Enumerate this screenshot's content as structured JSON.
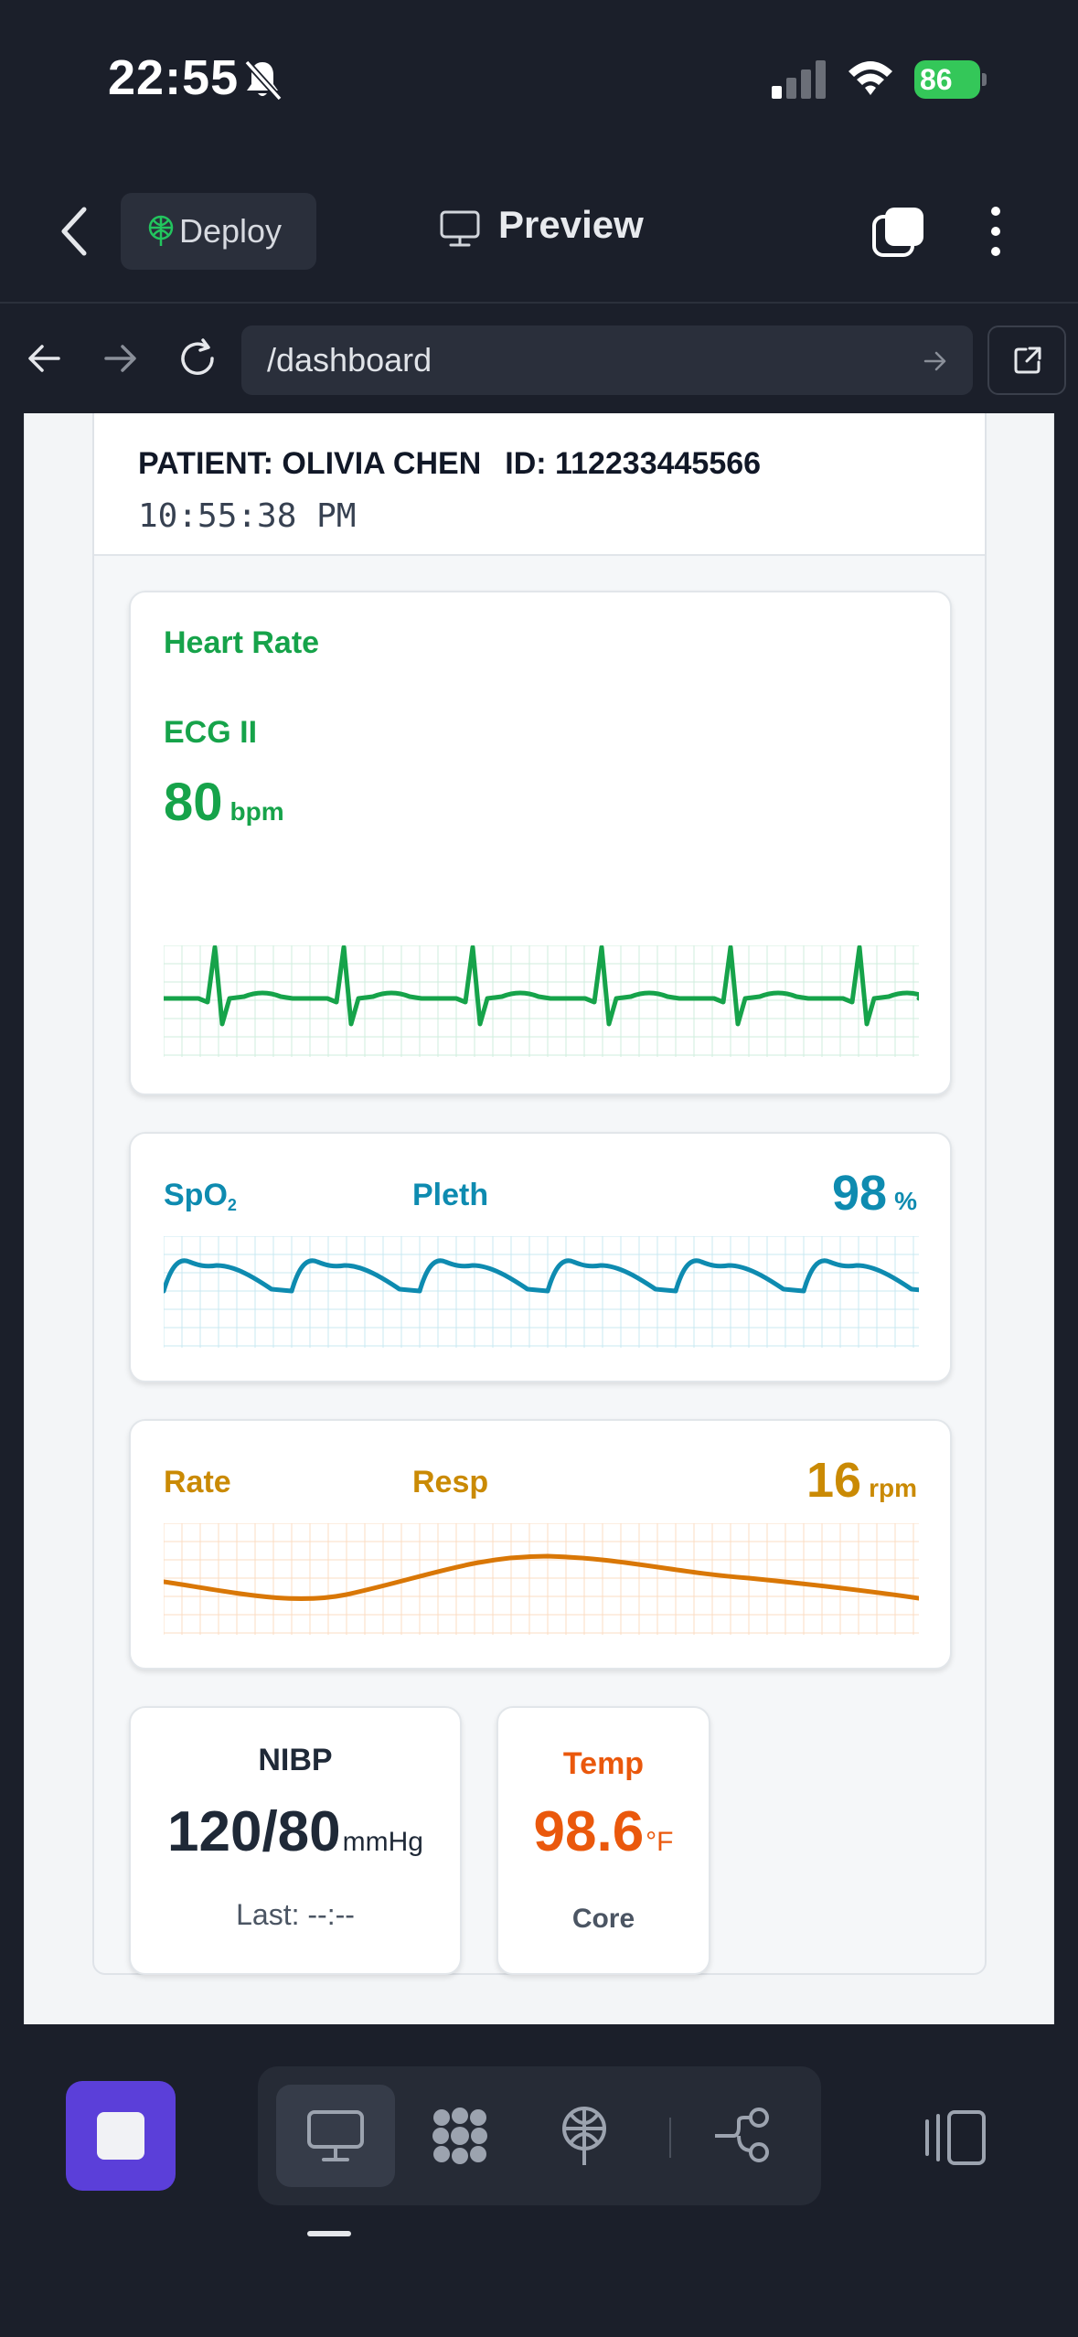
{
  "status_bar": {
    "time": "22:55",
    "battery": "86"
  },
  "toolbar": {
    "deploy_label": "Deploy",
    "preview_label": "Preview"
  },
  "browser": {
    "url": "/dashboard"
  },
  "monitor": {
    "patient_label": "PATIENT: OLIVIA CHEN",
    "patient_id": "ID: 112233445566",
    "clock": "10:55:38 PM",
    "heart_rate": {
      "title": "Heart Rate",
      "lead": "ECG II",
      "value": "80",
      "unit": "bpm",
      "color": "#16a34a"
    },
    "spo2": {
      "label": "SpO",
      "label_sub": "2",
      "wave_label": "Pleth",
      "value": "98",
      "unit": "%",
      "color": "#0e8bb0"
    },
    "resp": {
      "label": "Rate",
      "wave_label": "Resp",
      "value": "16",
      "unit": "rpm",
      "color": "#ca8a04"
    },
    "nibp": {
      "label": "NIBP",
      "value": "120/80",
      "unit": "mmHg",
      "last": "Last: --:--"
    },
    "temp": {
      "label": "Temp",
      "value": "98.6",
      "unit": "°F",
      "site": "Core",
      "color": "#ea580c"
    }
  },
  "bottom_bar": {
    "accent": "#5b3fd9",
    "items": [
      {
        "icon": "desktop-icon",
        "active": true
      },
      {
        "icon": "blocks-icon",
        "active": false
      },
      {
        "icon": "deploy-tree-icon",
        "active": false
      },
      {
        "icon": "branch-icon",
        "active": false
      }
    ]
  }
}
